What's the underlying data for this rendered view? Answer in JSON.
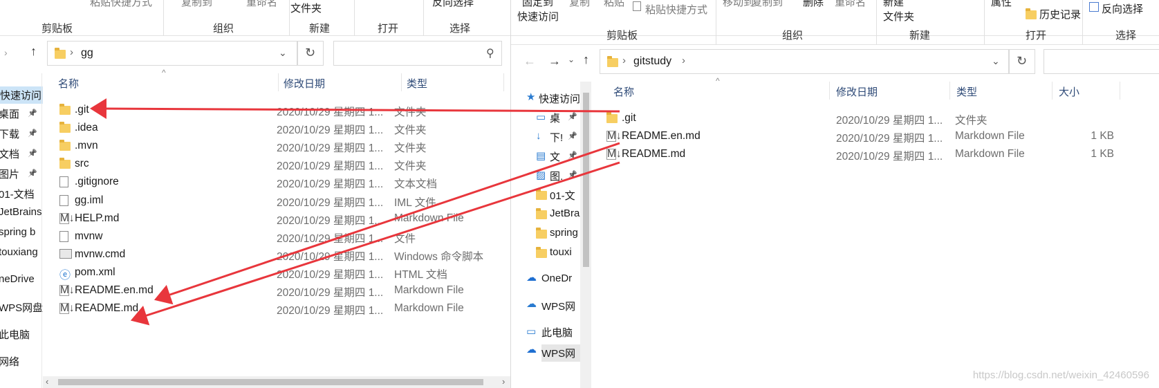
{
  "left": {
    "ribbon": {
      "top_cmds": [
        "粘贴快捷方式",
        "复制到",
        "重命名",
        "文件夹",
        "反向选择"
      ],
      "groups": [
        "剪贴板",
        "组织",
        "新建",
        "打开",
        "选择"
      ]
    },
    "address": {
      "path": "gg"
    },
    "columns": {
      "name": "名称",
      "date": "修改日期",
      "type": "类型"
    },
    "nav": [
      {
        "label": "快速访问",
        "pinned": false
      },
      {
        "label": "桌面",
        "pinned": true
      },
      {
        "label": "下载",
        "pinned": true
      },
      {
        "label": "文档",
        "pinned": true
      },
      {
        "label": "图片",
        "pinned": true
      },
      {
        "label": "01-文档",
        "pinned": false
      },
      {
        "label": "JetBrains",
        "pinned": false
      },
      {
        "label": "spring b",
        "pinned": false
      },
      {
        "label": "touxiang",
        "pinned": false
      },
      {
        "label": "neDrive",
        "pinned": false
      },
      {
        "label": "WPS网盘",
        "pinned": false
      },
      {
        "label": "此电脑",
        "pinned": false
      },
      {
        "label": "网络",
        "pinned": false
      }
    ],
    "files": [
      {
        "name": ".git",
        "date": "2020/10/29 星期四 1...",
        "type": "文件夹",
        "icon": "folder-icon"
      },
      {
        "name": ".idea",
        "date": "2020/10/29 星期四 1...",
        "type": "文件夹",
        "icon": "folder-icon"
      },
      {
        "name": ".mvn",
        "date": "2020/10/29 星期四 1...",
        "type": "文件夹",
        "icon": "folder-icon"
      },
      {
        "name": "src",
        "date": "2020/10/29 星期四 1...",
        "type": "文件夹",
        "icon": "folder-icon"
      },
      {
        "name": ".gitignore",
        "date": "2020/10/29 星期四 1...",
        "type": "文本文档",
        "icon": "text-file-icon"
      },
      {
        "name": "gg.iml",
        "date": "2020/10/29 星期四 1...",
        "type": "IML 文件",
        "icon": "file-icon"
      },
      {
        "name": "HELP.md",
        "date": "2020/10/29 星期四 1...",
        "type": "Markdown File",
        "icon": "markdown-file-icon"
      },
      {
        "name": "mvnw",
        "date": "2020/10/29 星期四 1...",
        "type": "文件",
        "icon": "file-icon"
      },
      {
        "name": "mvnw.cmd",
        "date": "2020/10/29 星期四 1...",
        "type": "Windows 命令脚本",
        "icon": "cmd-file-icon"
      },
      {
        "name": "pom.xml",
        "date": "2020/10/29 星期四 1...",
        "type": "HTML 文档",
        "icon": "html-file-icon"
      },
      {
        "name": "README.en.md",
        "date": "2020/10/29 星期四 1...",
        "type": "Markdown File",
        "icon": "markdown-file-icon"
      },
      {
        "name": "README.md",
        "date": "2020/10/29 星期四 1...",
        "type": "Markdown File",
        "icon": "markdown-file-icon"
      }
    ]
  },
  "right": {
    "ribbon": {
      "top_cmds": [
        "固定到",
        "复制",
        "粘贴",
        "粘贴快捷方式",
        "移动到",
        "复制到",
        "删除",
        "重命名",
        "新建",
        "属性",
        "历史记录",
        "反向选择"
      ],
      "second_line": [
        "快速访问",
        "文件夹"
      ],
      "groups": [
        "剪贴板",
        "组织",
        "新建",
        "打开",
        "选择"
      ]
    },
    "address": {
      "path": "gitstudy"
    },
    "columns": {
      "name": "名称",
      "date": "修改日期",
      "type": "类型",
      "size": "大小"
    },
    "nav": [
      {
        "label": "快速访问",
        "pinned": false
      },
      {
        "label": "桌",
        "pinned": true
      },
      {
        "label": "下!",
        "pinned": true
      },
      {
        "label": "文",
        "pinned": true
      },
      {
        "label": "图.",
        "pinned": true
      },
      {
        "label": "01-文",
        "pinned": false
      },
      {
        "label": "JetBra",
        "pinned": false
      },
      {
        "label": "spring",
        "pinned": false
      },
      {
        "label": "touxi",
        "pinned": false
      },
      {
        "label": "OneDr",
        "pinned": false
      },
      {
        "label": "WPS网",
        "pinned": false
      },
      {
        "label": "此电脑",
        "pinned": false
      },
      {
        "label": "WPS网",
        "pinned": false
      }
    ],
    "files": [
      {
        "name": ".git",
        "date": "2020/10/29 星期四 1...",
        "type": "文件夹",
        "size": "",
        "icon": "folder-icon"
      },
      {
        "name": "README.en.md",
        "date": "2020/10/29 星期四 1...",
        "type": "Markdown File",
        "size": "1 KB",
        "icon": "markdown-file-icon"
      },
      {
        "name": "README.md",
        "date": "2020/10/29 星期四 1...",
        "type": "Markdown File",
        "size": "1 KB",
        "icon": "markdown-file-icon"
      }
    ]
  },
  "watermark": "https://blog.csdn.net/weixin_42460596",
  "colors": {
    "arrow": "#e8363c",
    "folder": "#f7ce62",
    "header_text": "#2e4a77"
  }
}
